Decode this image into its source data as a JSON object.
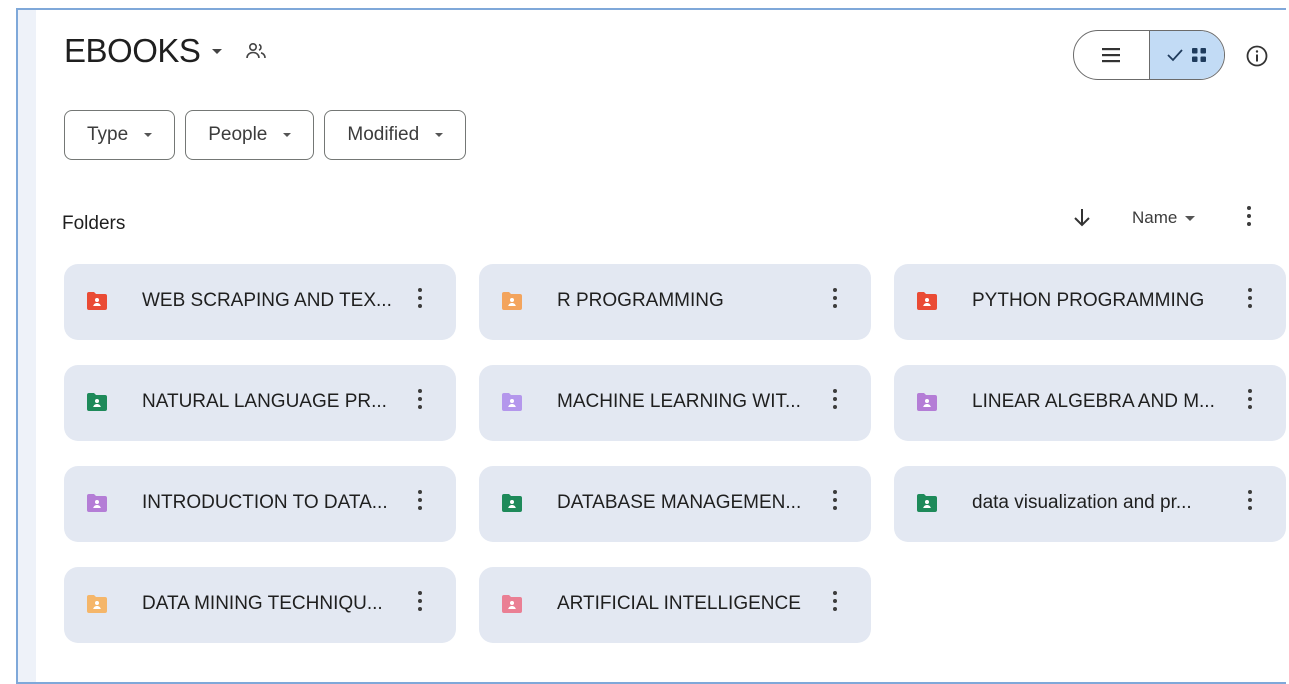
{
  "header": {
    "title": "EBOOKS"
  },
  "filters": [
    {
      "label": "Type"
    },
    {
      "label": "People"
    },
    {
      "label": "Modified"
    }
  ],
  "section": {
    "folders_label": "Folders",
    "sort_label": "Name"
  },
  "folders": [
    {
      "name": "WEB SCRAPING AND TEX...",
      "color": "#ea4b35"
    },
    {
      "name": "R PROGRAMMING",
      "color": "#f3a45d"
    },
    {
      "name": "PYTHON PROGRAMMING",
      "color": "#ea4b35"
    },
    {
      "name": "NATURAL LANGUAGE PR...",
      "color": "#1e8a5a"
    },
    {
      "name": "MACHINE LEARNING WIT...",
      "color": "#b497ec"
    },
    {
      "name": "LINEAR ALGEBRA AND M...",
      "color": "#b47dd6"
    },
    {
      "name": "INTRODUCTION TO DATA...",
      "color": "#b47dd6"
    },
    {
      "name": "DATABASE MANAGEMEN...",
      "color": "#1e8a5a"
    },
    {
      "name": "data visualization and pr...",
      "color": "#1e8a5a"
    },
    {
      "name": "DATA MINING TECHNIQU...",
      "color": "#f5b66a"
    },
    {
      "name": "ARTIFICIAL INTELLIGENCE",
      "color": "#ea7f94"
    }
  ],
  "icons": {
    "shared": "people-icon",
    "list_view": "list-icon",
    "grid_view": "grid-icon",
    "info": "info-icon",
    "sort": "arrow-down-icon",
    "more": "more-vert-icon",
    "folder": "shared-folder-icon"
  },
  "colors": {
    "card_bg": "#e3e8f2",
    "active_toggle": "#c2dbf5"
  }
}
